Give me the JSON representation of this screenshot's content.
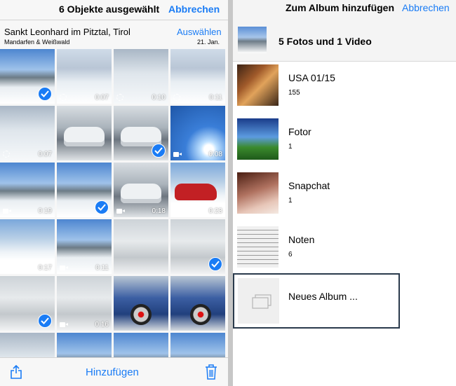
{
  "colors": {
    "accent": "#1a7cf5",
    "selection_border": "#2a3a4c"
  },
  "left_pane": {
    "nav": {
      "title": "6 Objekte ausgewählt",
      "cancel_label": "Abbrechen"
    },
    "section": {
      "title": "Sankt Leonhard im Pitztal, Tirol",
      "subtitle": "Mandarfen & Weißwald",
      "select_label": "Auswählen",
      "date": "21. Jan."
    },
    "grid": [
      {
        "badge": "",
        "duration": "",
        "selected": true
      },
      {
        "badge": "live",
        "duration": "0:07",
        "selected": false
      },
      {
        "badge": "live",
        "duration": "0:10",
        "selected": false
      },
      {
        "badge": "live",
        "duration": "0:11",
        "selected": false
      },
      {
        "badge": "live",
        "duration": "0:07",
        "selected": false
      },
      {
        "badge": "",
        "duration": "",
        "selected": false
      },
      {
        "badge": "",
        "duration": "",
        "selected": true
      },
      {
        "badge": "video",
        "duration": "0:08",
        "selected": false
      },
      {
        "badge": "video",
        "duration": "0:19",
        "selected": false
      },
      {
        "badge": "",
        "duration": "",
        "selected": true
      },
      {
        "badge": "video",
        "duration": "0:18",
        "selected": false
      },
      {
        "badge": "video",
        "duration": "0:23",
        "selected": false
      },
      {
        "badge": "video",
        "duration": "0:17",
        "selected": false
      },
      {
        "badge": "video",
        "duration": "0:11",
        "selected": false
      },
      {
        "badge": "",
        "duration": "",
        "selected": false
      },
      {
        "badge": "",
        "duration": "",
        "selected": true
      },
      {
        "badge": "",
        "duration": "",
        "selected": true
      },
      {
        "badge": "video",
        "duration": "0:16",
        "selected": false
      },
      {
        "badge": "",
        "duration": "",
        "selected": false
      },
      {
        "badge": "",
        "duration": "",
        "selected": false
      }
    ],
    "toolbar": {
      "add_label": "Hinzufügen",
      "share_icon": "share-icon",
      "trash_icon": "trash-icon"
    }
  },
  "right_pane": {
    "nav": {
      "title": "Zum Album hinzufügen",
      "cancel_label": "Abbrechen"
    },
    "selection_summary": "5 Fotos und 1 Video",
    "albums": [
      {
        "name": "USA 01/15",
        "count": "155"
      },
      {
        "name": "Fotor",
        "count": "1"
      },
      {
        "name": "Snapchat",
        "count": "1"
      },
      {
        "name": "Noten",
        "count": "6"
      }
    ],
    "new_album_label": "Neues Album ..."
  }
}
